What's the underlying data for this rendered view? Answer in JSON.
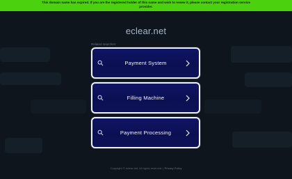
{
  "banner": {
    "line1": "This domain name has expired. If you are the registered holder of this name and wish to renew it, please contact your registration service",
    "line2": "provider."
  },
  "domain": "eclear.net",
  "related_label": "Related searches:",
  "cards": [
    {
      "label": "Payment System",
      "icon": "search-icon",
      "arrow_icon": "chevron-right-icon"
    },
    {
      "label": "Filling Machine",
      "icon": "search-icon",
      "arrow_icon": "chevron-right-icon"
    },
    {
      "label": "Payment Processing",
      "icon": "search-icon",
      "arrow_icon": "chevron-right-icon"
    }
  ],
  "footer": {
    "copyright": "Copyright © eclear.net.  All rights reserved.",
    "privacy": "Privacy Policy"
  },
  "colors": {
    "banner": "#4cd10f",
    "background": "#0f151c",
    "card_fill": "#0b1053",
    "card_border": "#eef1ff",
    "card_text": "#f3f6ff"
  }
}
